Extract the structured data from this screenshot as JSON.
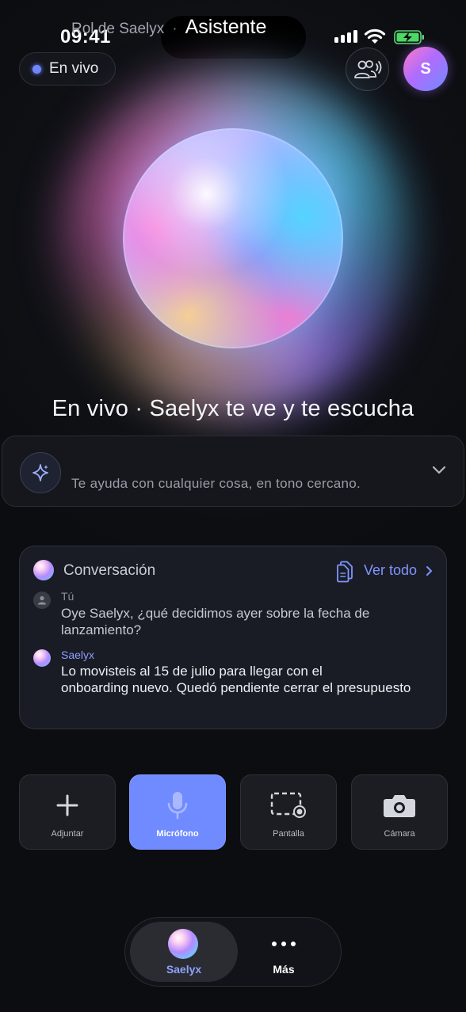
{
  "status_bar": {
    "time": "09:41"
  },
  "header": {
    "live_label": "En vivo",
    "avatar_initial": "S"
  },
  "headline": "En vivo · Saelyx te ve y te escucha",
  "role": {
    "prefix": "Rol de Saelyx",
    "separator": "·",
    "name": "Asistente",
    "description": "Te ayuda con cualquier cosa, en tono cercano."
  },
  "conversation": {
    "title": "Conversación",
    "view_all": "Ver todo",
    "messages": [
      {
        "author": "Tú",
        "text": "Oye Saelyx, ¿qué decidimos ayer sobre la fecha de lanzamiento?"
      },
      {
        "author": "Saelyx",
        "line1": "Lo movisteis al 15 de julio para llegar con el",
        "line2": "onboarding nuevo. Quedó pendiente cerrar el presupuesto"
      }
    ]
  },
  "actions": [
    {
      "label": "Adjuntar",
      "icon": "plus-icon",
      "active": false
    },
    {
      "label": "Micrófono",
      "icon": "microphone-icon",
      "active": true
    },
    {
      "label": "Pantalla",
      "icon": "screen-record-icon",
      "active": false
    },
    {
      "label": "Cámara",
      "icon": "camera-icon",
      "active": false
    }
  ],
  "nav": {
    "items": [
      {
        "label": "Saelyx",
        "selected": true
      },
      {
        "label": "Más",
        "selected": false
      }
    ]
  },
  "colors": {
    "accent": "#6f8bff",
    "background": "#0c0d10",
    "link": "#7f95ff"
  }
}
